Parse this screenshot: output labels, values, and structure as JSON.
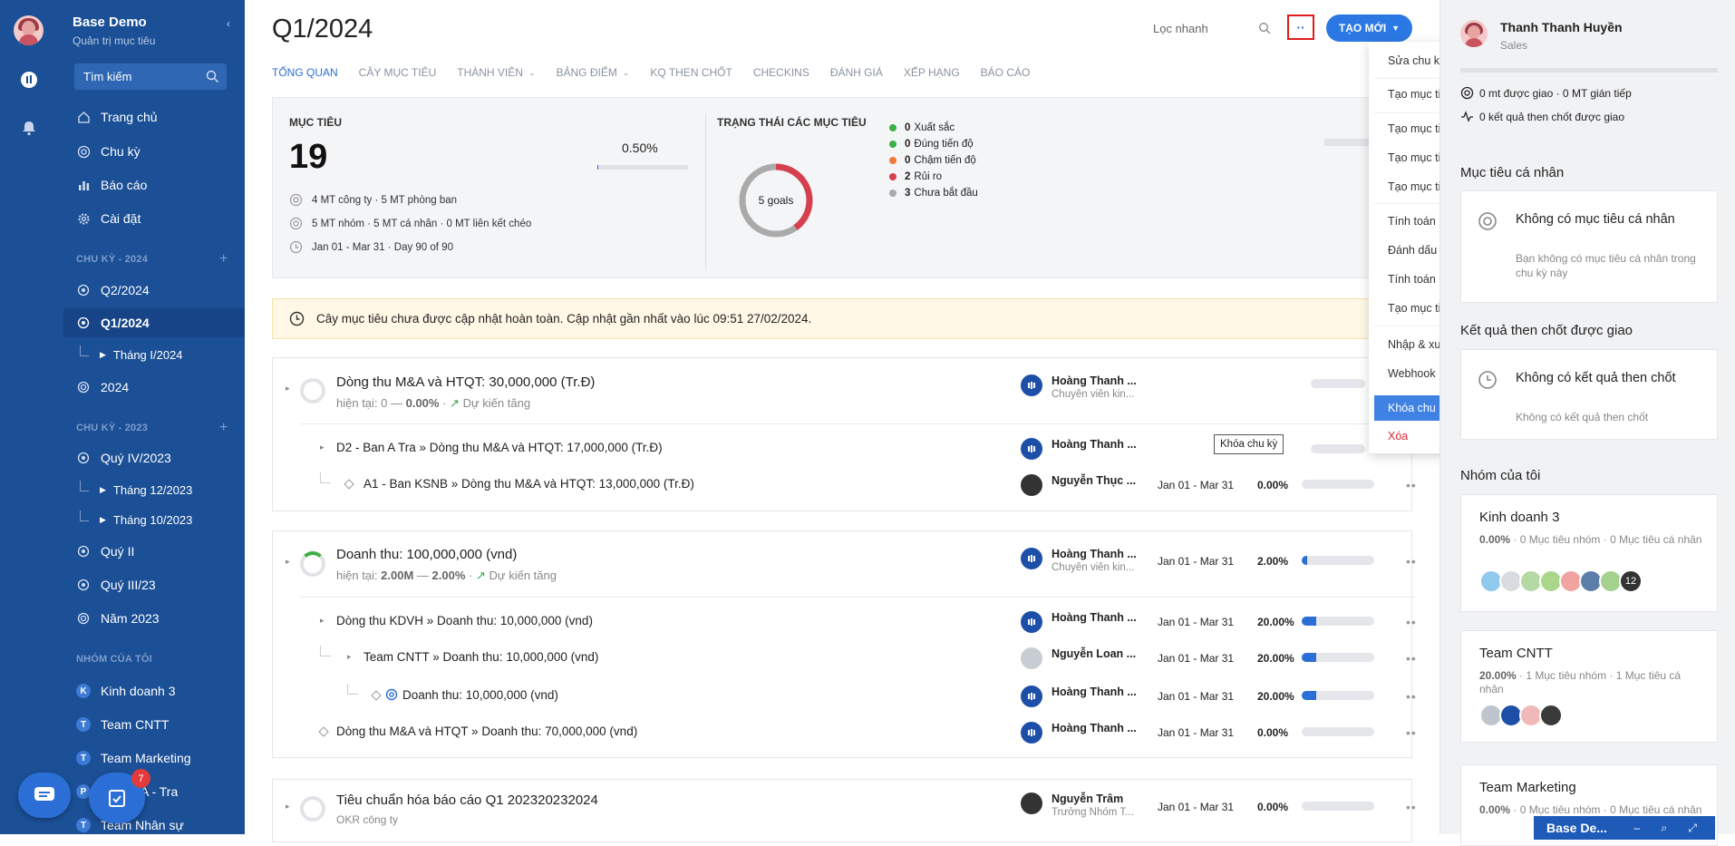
{
  "app": {
    "brand": "Base Demo",
    "brand_sub": "Quản trị mục tiêu",
    "search_placeholder": "Tìm kiếm",
    "task_badge": "7"
  },
  "nav": {
    "home": "Trang chủ",
    "cycle": "Chu kỳ",
    "report": "Báo cáo",
    "settings": "Cài đặt",
    "section_2024": "CHU KỲ - 2024",
    "q2_2024": "Q2/2024",
    "q1_2024": "Q1/2024",
    "thang1_2024": "Tháng I/2024",
    "y2024": "2024",
    "section_2023": "CHU KỲ - 2023",
    "q4_2023": "Quý IV/2023",
    "thang12_2023": "Tháng 12/2023",
    "thang10_2023": "Tháng 10/2023",
    "quy2": "Quý II",
    "quy3_23": "Quý III/23",
    "nam2023": "Năm 2023",
    "section_groups": "NHÓM CỦA TÔI",
    "groups": [
      {
        "badge": "K",
        "label": "Kinh doanh 3"
      },
      {
        "badge": "T",
        "label": "Team CNTT"
      },
      {
        "badge": "T",
        "label": "Team Marketing"
      },
      {
        "badge": "P",
        "label": "A - Tra"
      },
      {
        "badge": "T",
        "label": "Team Nhân sự"
      }
    ]
  },
  "header": {
    "title": "Q1/2024",
    "quick_filter": "Lọc nhanh",
    "more": "··",
    "create": "TẠO MỚI"
  },
  "tabs": [
    "TỔNG QUAN",
    "CÂY MỤC TIÊU",
    "THÀNH VIÊN",
    "BẢNG ĐIỂM",
    "KQ THEN CHỐT",
    "CHECKINS",
    "ĐÁNH GIÁ",
    "XẾP HẠNG",
    "BÁO CÁO"
  ],
  "summary": {
    "goals_heading": "MỤC TIÊU",
    "goals_count": "19",
    "goals_pct": "0.50%",
    "goals_progress": 0.005,
    "line1": "4 MT công ty · 5 MT phòng ban",
    "line2": "5 MT nhóm · 5 MT cá nhân · 0 MT liên kết chéo",
    "line3": "Jan 01 - Mar 31 · Day 90 of 90",
    "status_heading": "TRẠNG THÁI CÁC MỤC TIÊU",
    "donut_label": "5 goals",
    "legend": [
      {
        "count": "0",
        "label": "Xuất sắc",
        "color": "#3cb043"
      },
      {
        "count": "0",
        "label": "Đúng tiến độ",
        "color": "#3cb043"
      },
      {
        "count": "0",
        "label": "Chậm tiến độ",
        "color": "#f07a3a"
      },
      {
        "count": "2",
        "label": "Rủi ro",
        "color": "#d6404e"
      },
      {
        "count": "3",
        "label": "Chưa bắt đầu",
        "color": "#aaaaaa"
      }
    ]
  },
  "notice": "Cây mục tiêu chưa được cập nhật hoàn toàn. Cập nhật gần nhất vào lúc 09:51 27/02/2024.",
  "goals": {
    "g1": {
      "title": "Dòng thu M&A và HTQT: 30,000,000 (Tr.Đ)",
      "sub_a": "hiện tại: 0 — ",
      "sub_pct": "0.00%",
      "sub_trend": "Dự kiến tăng",
      "owner": "Hoàng Thanh ...",
      "role": "Chuyên viên kin..."
    },
    "g1a": {
      "title": "D2 - Ban A Tra » Dòng thu M&A và HTQT: 17,000,000 (Tr.Đ)",
      "owner": "Hoàng Thanh ..."
    },
    "g1b": {
      "title": "A1 - Ban KSNB » Dòng thu M&A và HTQT: 13,000,000 (Tr.Đ)",
      "owner": "Nguyễn Thục ...",
      "date": "Jan 01 - Mar 31",
      "pct": "0.00%",
      "progress": 0
    },
    "g2": {
      "title": "Doanh thu: 100,000,000 (vnd)",
      "sub_a": "hiện tại: ",
      "sub_val": "2.00M",
      "sub_b": " — ",
      "sub_pct": "2.00%",
      "sub_trend": "Dự kiến tăng",
      "owner": "Hoàng Thanh ...",
      "role": "Chuyên viên kin...",
      "date": "Jan 01 - Mar 31",
      "pct": "2.00%",
      "progress": 0.02
    },
    "g2a": {
      "title": "Dòng thu KDVH » Doanh thu: 10,000,000 (vnd)",
      "owner": "Hoàng Thanh ...",
      "date": "Jan 01 - Mar 31",
      "pct": "20.00%",
      "progress": 0.2
    },
    "g2b": {
      "title": "Team CNTT » Doanh thu: 10,000,000 (vnd)",
      "owner": "Nguyễn Loan ...",
      "date": "Jan 01 - Mar 31",
      "pct": "20.00%",
      "progress": 0.2
    },
    "g2c": {
      "title": "Doanh thu: 10,000,000 (vnd)",
      "owner": "Hoàng Thanh ...",
      "date": "Jan 01 - Mar 31",
      "pct": "20.00%",
      "progress": 0.2
    },
    "g2d": {
      "title": "Dòng thu M&A và HTQT » Doanh thu: 70,000,000 (vnd)",
      "owner": "Hoàng Thanh ...",
      "date": "Jan 01 - Mar 31",
      "pct": "0.00%",
      "progress": 0
    },
    "g3": {
      "title": "Tiêu chuẩn hóa báo cáo Q1 202320232024",
      "sub": "OKR công ty",
      "owner": "Nguyễn Trâm",
      "role": "Trưởng Nhóm T...",
      "date": "Jan 01 - Mar 31",
      "pct": "0.00%",
      "progress": 0
    }
  },
  "menu": {
    "edit_cycle": "Sửa chu kỳ",
    "create_personal": "Tạo mục tiêu cá nhân",
    "create_team": "Tạo mục tiêu của nhóm",
    "create_dept": "Tạo mục tiêu phòng ban",
    "create_company": "Tạo mục tiêu công ty",
    "recalc_tree": "Tính toán lại cây mục tiêu",
    "mark_current": "Đánh dấu là chu kỳ hiện tại",
    "recalc_goals": "Tính toán lại các mục tiêu c...",
    "create_linked": "Tạo mục tiêu liên kết từ chu...",
    "import_export": "Nhập & xuất",
    "webhook": "Webhook",
    "lock_cycle": "Khóa chu kỳ",
    "delete": "Xóa",
    "tooltip": "Khóa chu kỳ"
  },
  "right": {
    "user_name": "Thanh Thanh Huyền",
    "user_role": "Sales",
    "stat1": "0 mt được giao · 0 MT gián tiếp",
    "stat2": "0 kết quả then chốt được giao",
    "personal_heading": "Mục tiêu cá nhân",
    "personal_empty_title": "Không có mục tiêu cá nhân",
    "personal_empty_desc": "Bạn không có mục tiêu cá nhân trong chu kỳ này",
    "kr_heading": "Kết quả then chốt được giao",
    "kr_empty_title": "Không có kết quả then chốt",
    "kr_empty_desc": "Không có kết quả then chốt",
    "groups_heading": "Nhóm của tôi",
    "team1_name": "Kinh doanh 3",
    "team1_pct": "0.00%",
    "team1_rest": " · 0 Mục tiêu nhóm · 0 Mục tiêu cá nhân",
    "team1_more": "12",
    "team2_name": "Team CNTT",
    "team2_pct": "20.00%",
    "team2_rest": " · 1 Mục tiêu nhóm · 1 Mục tiêu cá nhân",
    "team3_name": "Team Marketing",
    "team3_pct": "0.00%",
    "team3_rest": " · 0 Mục tiêu nhóm · 0 Mục tiêu cá nhân",
    "chat_title": "Base De..."
  }
}
